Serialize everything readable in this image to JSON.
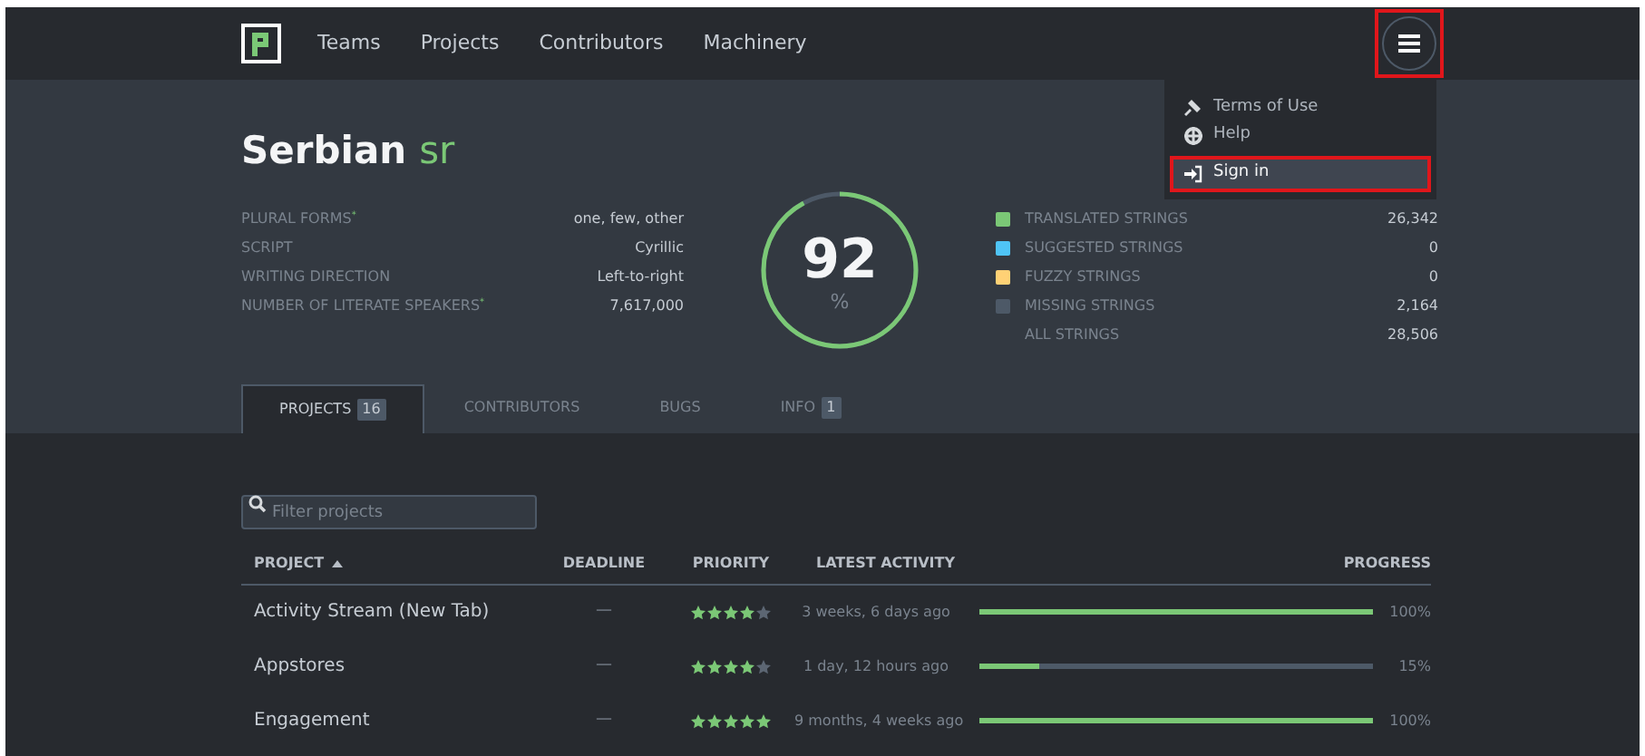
{
  "nav": {
    "items": [
      "Teams",
      "Projects",
      "Contributors",
      "Machinery"
    ],
    "menu_highlighted": true
  },
  "menu": {
    "items": [
      {
        "label": "Terms of Use",
        "kind": "gavel",
        "highlighted": false
      },
      {
        "label": "Help",
        "kind": "lifebuoy",
        "highlighted": false
      },
      {
        "label": "Sign in",
        "kind": "signin",
        "highlighted": true
      }
    ]
  },
  "heading": {
    "name": "Serbian",
    "code": "sr"
  },
  "details": [
    {
      "label": "PLURAL FORMS",
      "mark": "*",
      "value": "one, few, other"
    },
    {
      "label": "SCRIPT",
      "value": "Cyrillic"
    },
    {
      "label": "WRITING DIRECTION",
      "value": "Left-to-right"
    },
    {
      "label": "NUMBER OF LITERATE SPEAKERS",
      "mark": "*",
      "value": "7,617,000"
    }
  ],
  "progress_ring": {
    "value": "92",
    "unit": "%",
    "level": 0.92
  },
  "legend": [
    {
      "label": "TRANSLATED STRINGS",
      "value": "26,342",
      "color": "#7bc876"
    },
    {
      "label": "SUGGESTED STRINGS",
      "value": "0",
      "color": "#4fc4f6"
    },
    {
      "label": "FUZZY STRINGS",
      "value": "0",
      "color": "#ffd175"
    },
    {
      "label": "MISSING STRINGS",
      "value": "2,164",
      "color": "#4d5967"
    },
    {
      "label": "ALL STRINGS",
      "value": "28,506"
    }
  ],
  "tabs": [
    {
      "label": "PROJECTS",
      "count": "16",
      "selected": true
    },
    {
      "label": "CONTRIBUTORS",
      "selected": false
    },
    {
      "label": "BUGS",
      "selected": false
    },
    {
      "label": "INFO",
      "count": "1",
      "selected": false
    }
  ],
  "search": {
    "placeholder": "Filter projects"
  },
  "table": {
    "columns": [
      "PROJECT",
      "DEADLINE",
      "PRIORITY",
      "LATEST ACTIVITY",
      "PROGRESS"
    ],
    "rows": [
      {
        "project": "Activity Stream (New Tab)",
        "deadline": "—",
        "stars": 4,
        "activity": "3 weeks, 6 days ago",
        "level": 1.0,
        "percent": "100%"
      },
      {
        "project": "Appstores",
        "deadline": "—",
        "stars": 4,
        "activity": "1 day, 12 hours ago",
        "level": 0.15,
        "percent": "15%"
      },
      {
        "project": "Engagement",
        "deadline": "—",
        "stars": 5,
        "activity": "9 months, 4 weeks ago",
        "level": 1.0,
        "percent": "100%"
      }
    ]
  }
}
